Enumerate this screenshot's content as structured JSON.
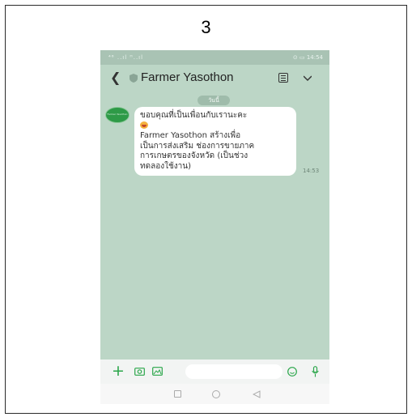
{
  "figure": {
    "number": "3"
  },
  "status_bar": {
    "left_text": "⁴⁶ ..ıl ᴴ..ıl",
    "right_text": "⊙ ▭ 14:54"
  },
  "header": {
    "title": "Farmer Yasothon"
  },
  "chat": {
    "date_pill": "วันนี้",
    "avatar_text": "Farmer Yasothon",
    "message": {
      "line1": "ขอบคุณที่เป็นเพื่อนกับเรานะคะ",
      "line3": "Farmer Yasothon สร้างเพื่อ",
      "line4": "เป็นการส่งเสริม ช่องการขายภาค",
      "line5": "การเกษตรของจังหวัด (เป็นช่วง",
      "line6": "ทดลองใช้งาน)"
    },
    "time": "14:53"
  },
  "colors": {
    "chat_background": "#bcd6c6",
    "accent_green": "#2aa64a",
    "bubble": "#ffffff"
  },
  "icons": {
    "back": "back-chevron-icon",
    "verified": "shield-icon",
    "notes": "notes-icon",
    "menu": "chevron-down-icon",
    "plus": "plus-icon",
    "camera": "camera-icon",
    "image": "image-icon",
    "emoji": "emoji-icon",
    "mic": "mic-icon"
  }
}
